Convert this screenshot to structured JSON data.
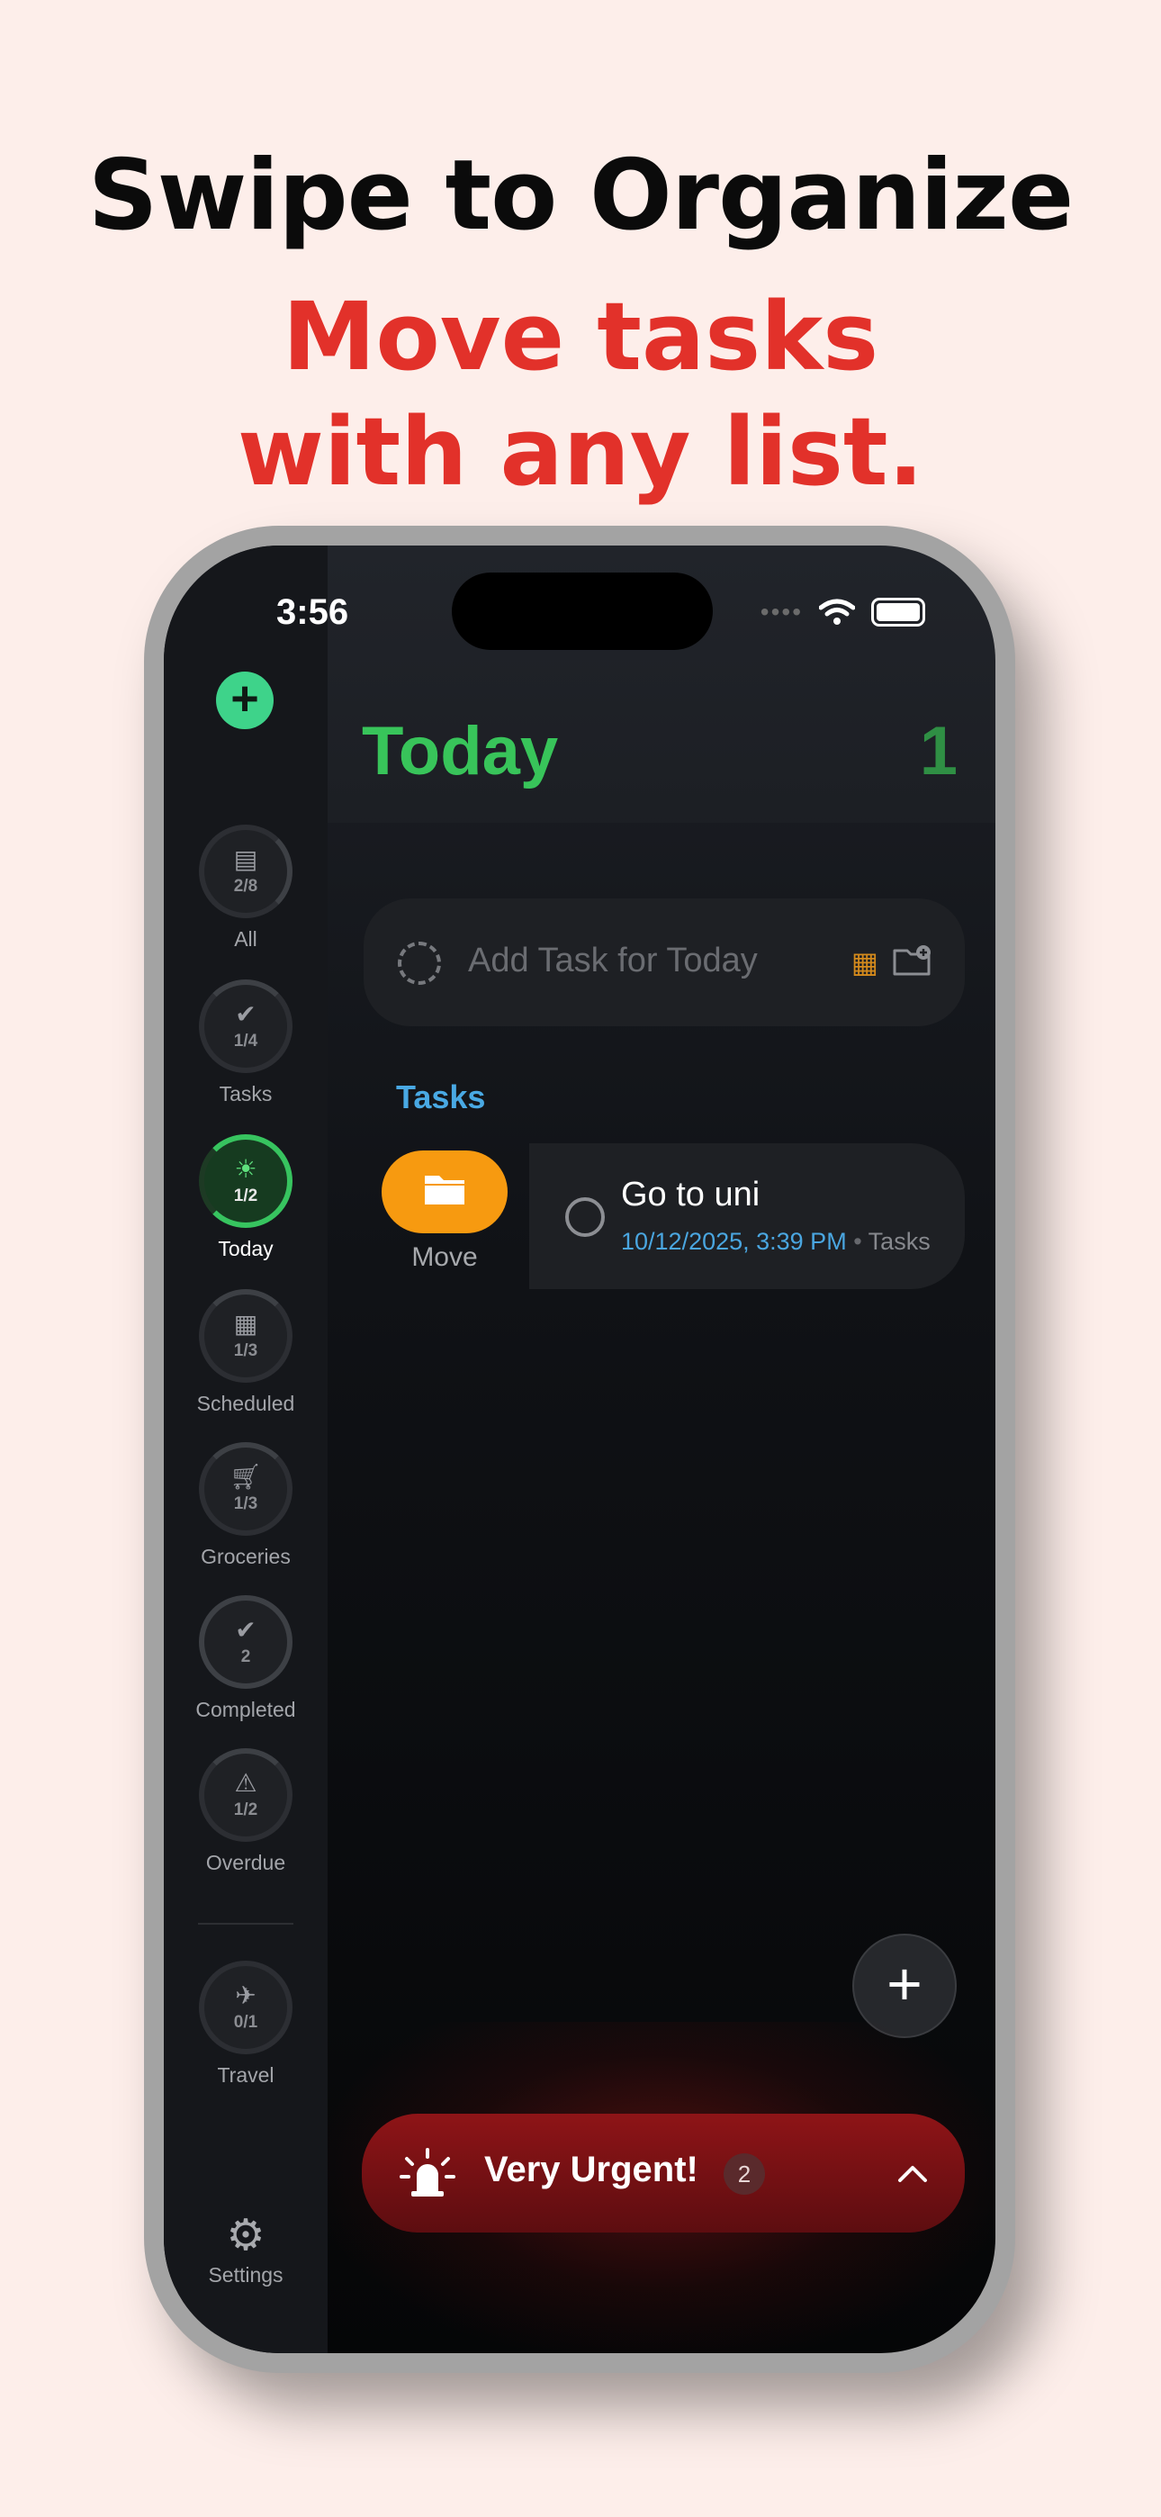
{
  "headline": {
    "line1": "Swipe to Organize",
    "line2a": "Move tasks",
    "line2b": "with any list."
  },
  "status_bar": {
    "time": "3:56"
  },
  "sidebar": {
    "items": [
      {
        "label": "All",
        "count": "2/8",
        "icon": "tray-icon"
      },
      {
        "label": "Tasks",
        "count": "1/4",
        "icon": "check-circle-icon"
      },
      {
        "label": "Today",
        "count": "1/2",
        "icon": "sun-icon"
      },
      {
        "label": "Scheduled",
        "count": "1/3",
        "icon": "calendar-alert-icon"
      },
      {
        "label": "Groceries",
        "count": "1/3",
        "icon": "cart-icon"
      },
      {
        "label": "Completed",
        "count": "2",
        "icon": "checkmark-seal-icon"
      },
      {
        "label": "Overdue",
        "count": "1/2",
        "icon": "warning-icon"
      },
      {
        "label": "Travel",
        "count": "0/1",
        "icon": "airplane-icon"
      }
    ],
    "settings_label": "Settings"
  },
  "main": {
    "title": "Today",
    "count": "1",
    "add_task_placeholder": "Add Task for Today",
    "section_title": "Tasks",
    "move_label": "Move",
    "task": {
      "title": "Go to uni",
      "date": "10/12/2025, 3:39 PM",
      "separator": "•",
      "list": "Tasks"
    }
  },
  "urgent": {
    "label": "Very Urgent!",
    "count": "2"
  },
  "colors": {
    "background": "#fdeeea",
    "headline_red": "#e2312a",
    "accent_green": "#38c45a",
    "accent_blue": "#49a9e4",
    "move_orange": "#f79a10",
    "urgent_red": "#8e1417"
  }
}
